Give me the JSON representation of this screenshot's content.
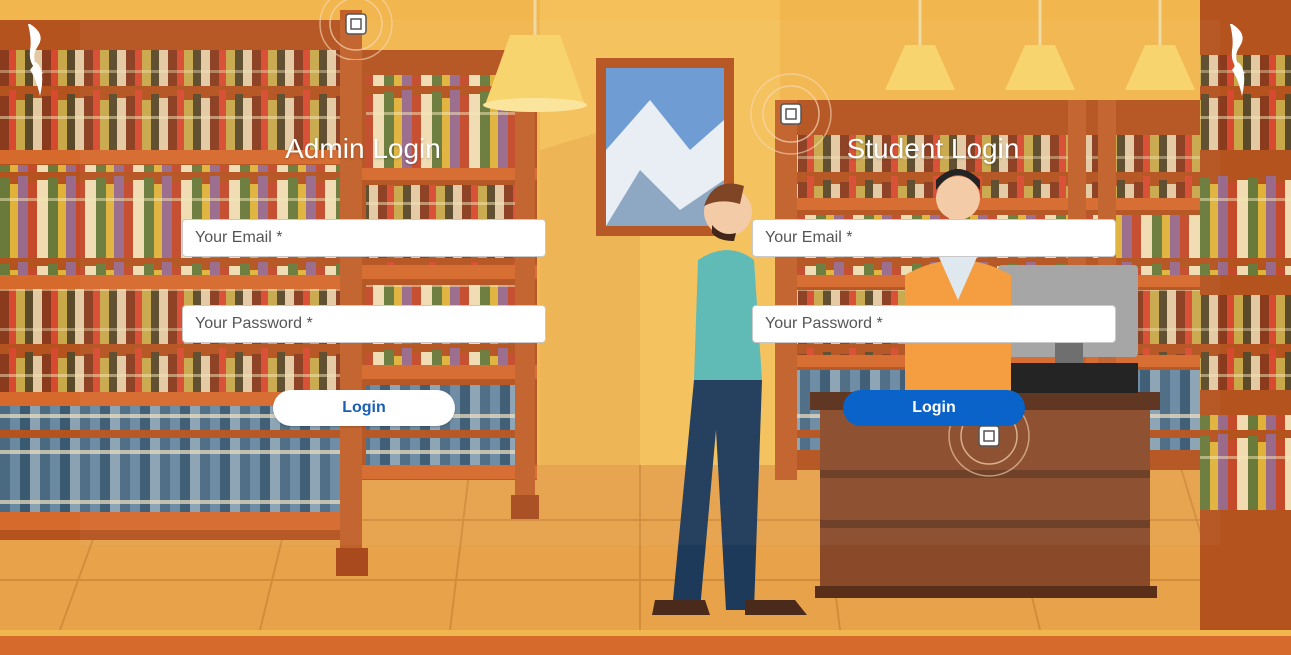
{
  "admin": {
    "title": "Admin Login",
    "email_placeholder": "Your Email *",
    "password_placeholder": "Your Password *",
    "login_label": "Login"
  },
  "student": {
    "title": "Student Login",
    "email_placeholder": "Your Email *",
    "password_placeholder": "Your Password *",
    "login_label": "Login"
  },
  "colors": {
    "wall": "#f2b64e",
    "floor": "#e8a24a",
    "shelf": "#b5531f",
    "button_primary": "#0a63c9"
  }
}
